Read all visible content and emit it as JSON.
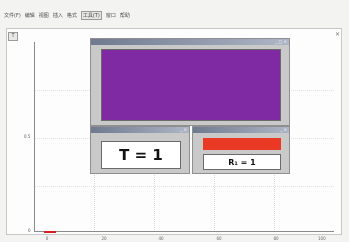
{
  "menubar": {
    "items": [
      "文件(F)",
      "编辑",
      "视图",
      "插入",
      "格式",
      "工具(T)",
      "窗口",
      "帮助"
    ],
    "selected": "工具(T)"
  },
  "frame": {
    "tab_label": "T",
    "close_glyph": "×"
  },
  "plot": {
    "y_ticks": [
      "",
      "0.5",
      "0"
    ],
    "x_ticks": [
      "0",
      "20",
      "40",
      "60",
      "80",
      "100"
    ]
  },
  "color_window": {
    "title": "",
    "controls": "_ □ ×",
    "swatch_color": "#7f2aa2"
  },
  "t_window": {
    "title": "",
    "controls": "_ ×",
    "label": "T = 1"
  },
  "r_window": {
    "title": "",
    "controls": "_ ×",
    "bar_color": "#ea3a26",
    "label": "R₁ = 1"
  }
}
